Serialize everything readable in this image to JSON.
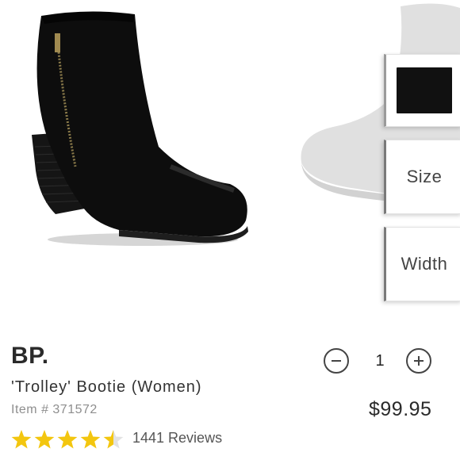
{
  "product": {
    "brand": "BP.",
    "name": "'Trolley'  Bootie (Women)",
    "item_number": "Item # 371572",
    "price": "$99.95",
    "rating": 4.5,
    "reviews": "1441 Reviews"
  },
  "options": {
    "size_label": "Size",
    "width_label": "Width",
    "swatch_color": "#111111"
  },
  "quantity": {
    "value": "1"
  },
  "icons": {
    "decrease": "minus-circle-icon",
    "increase": "plus-circle-icon",
    "rating": "star-icon"
  },
  "colors": {
    "star": "#f3c60f",
    "text": "#222222",
    "muted": "#8e8e8e"
  }
}
